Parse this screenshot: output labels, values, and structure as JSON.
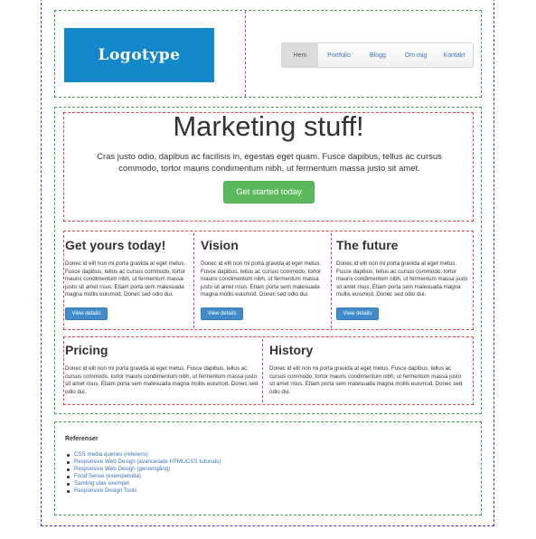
{
  "header": {
    "logo_text": "Logotype",
    "nav": [
      {
        "label": "Hem",
        "active": true
      },
      {
        "label": "Portfolio",
        "active": false
      },
      {
        "label": "Blogg",
        "active": false
      },
      {
        "label": "Om mig",
        "active": false
      },
      {
        "label": "Kontakt",
        "active": false
      }
    ]
  },
  "hero": {
    "title": "Marketing stuff!",
    "lead": "Cras justo odio, dapibus ac facilisis in, egestas eget quam. Fusce dapibus, tellus ac cursus commodo, tortor mauris condimentum nibh, ut fermentum massa justo sit amet.",
    "button": "Get started today"
  },
  "columns": [
    {
      "title": "Get yours today!",
      "text": "Donec id elit non mi porta gravida at eget metus. Fusce dapibus, tellus ac cursus commodo, tortor mauris condimentum nibh, ut fermentum massa justo sit amet risus. Etiam porta sem malesuada magna mollis euismod. Donec sed odio dui.",
      "button": "View details"
    },
    {
      "title": "Vision",
      "text": "Donec id elit non mi porta gravida at eget metus. Fusce dapibus, tellus ac cursus commodo, tortor mauris condimentum nibh, ut fermentum massa justo sit amet risus. Etiam porta sem malesuada magna mollis euismod. Donec sed odio dui.",
      "button": "View details"
    },
    {
      "title": "The future",
      "text": "Donec id elit non mi porta gravida at eget metus. Fusce dapibus, tellus ac cursus commodo, tortor mauris condimentum nibh, ut fermentum massa justo sit amet risus. Etiam porta sem malesuada magna mollis euismod. Donec sed odio dui.",
      "button": "View details"
    }
  ],
  "wide": [
    {
      "title": "Pricing",
      "text": "Donec id elit non mi porta gravida at eget metus. Fusce dapibus, tellus ac cursus commodo, tortor mauris condimentum nibh, ut fermentum massa justo sit amet risus. Etiam porta sem malesuada magna mollis euismod. Donec sed odio dui."
    },
    {
      "title": "History",
      "text": "Donec id elit non mi porta gravida at eget metus. Fusce dapibus, tellus ac cursus commodo, tortor mauris condimentum nibh, ut fermentum massa justo sit amet risus. Etiam porta sem malesuada magna mollis euismod. Donec sed odio dui."
    }
  ],
  "references": {
    "title": "Referenser",
    "links": [
      "CSS media queries (referens)",
      "Responsive Web Design (avancerade HTML/CSS tutorials)",
      "Responsive Web Design (genomgång)",
      "Food Sense (exempelsida)",
      "Samling utav exempel",
      "Responsive Design Tools"
    ]
  }
}
